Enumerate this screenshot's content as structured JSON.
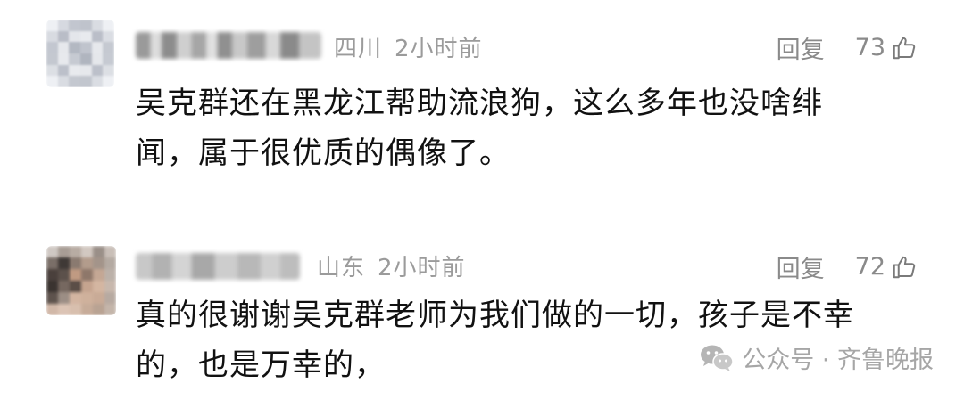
{
  "comments": [
    {
      "location": "四川",
      "time": "2小时前",
      "reply_label": "回复",
      "likes": "73",
      "line1": "吴克群还在黑龙江帮助流浪狗，这么多年也没啥绯",
      "line2": "闻，属于很优质的偶像了。"
    },
    {
      "location": "山东",
      "time": "2小时前",
      "reply_label": "回复",
      "likes": "72",
      "line1": "真的很谢谢吴克群老师为我们做的一切，孩子是不幸",
      "line2": "的，也是万幸的，"
    }
  ],
  "watermark": {
    "text": "公众号 · 齐鲁晚报"
  },
  "icons": {
    "like": "thumbs-up-icon",
    "watermark": "wechat-icon"
  },
  "colors": {
    "meta": "#9b9b9b",
    "text": "#111111",
    "action": "#8a8a8a"
  }
}
